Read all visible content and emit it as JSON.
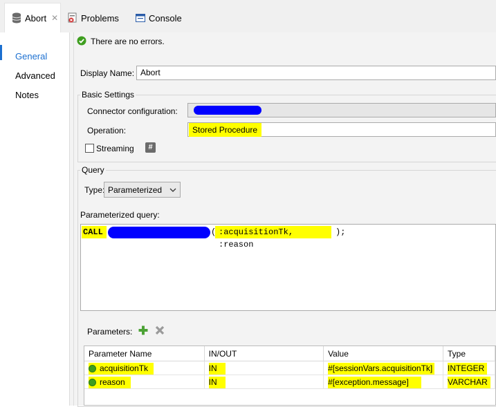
{
  "tabs": [
    {
      "label": "Abort",
      "icon": "database-icon"
    },
    {
      "label": "Problems",
      "icon": "problems-icon"
    },
    {
      "label": "Console",
      "icon": "console-icon"
    }
  ],
  "status": {
    "text": "There are no errors.",
    "icon": "check-circle-icon"
  },
  "nav": {
    "items": [
      "General",
      "Advanced",
      "Notes"
    ],
    "active": "General",
    "accent": "#1b6fd0"
  },
  "display_name": {
    "label": "Display Name:",
    "value": "Abort"
  },
  "basic_settings": {
    "title": "Basic Settings",
    "connector_label": "Connector configuration:",
    "operation_label": "Operation:",
    "operation_value": "Stored Procedure",
    "streaming_label": "Streaming"
  },
  "query": {
    "title": "Query",
    "type_label": "Type:",
    "type_value": "Parameterized",
    "param_query_label": "Parameterized query:",
    "sql_call": "CALL",
    "sql_params": ":acquisitionTk, :reason",
    "sql_open": "(",
    "sql_close": ");"
  },
  "parameters": {
    "label": "Parameters:",
    "columns": [
      "Parameter Name",
      "IN/OUT",
      "Value",
      "Type"
    ],
    "rows": [
      {
        "name": "acquisitionTk",
        "direction": "IN",
        "value": "#[sessionVars.acquisitionTk]",
        "type": "INTEGER"
      },
      {
        "name": "reason",
        "direction": "IN",
        "value": "#[exception.message]",
        "type": "VARCHAR"
      }
    ]
  },
  "colors": {
    "highlight": "#ffff00",
    "redaction": "#0000ff",
    "status_ok": "#3e9e1f"
  }
}
